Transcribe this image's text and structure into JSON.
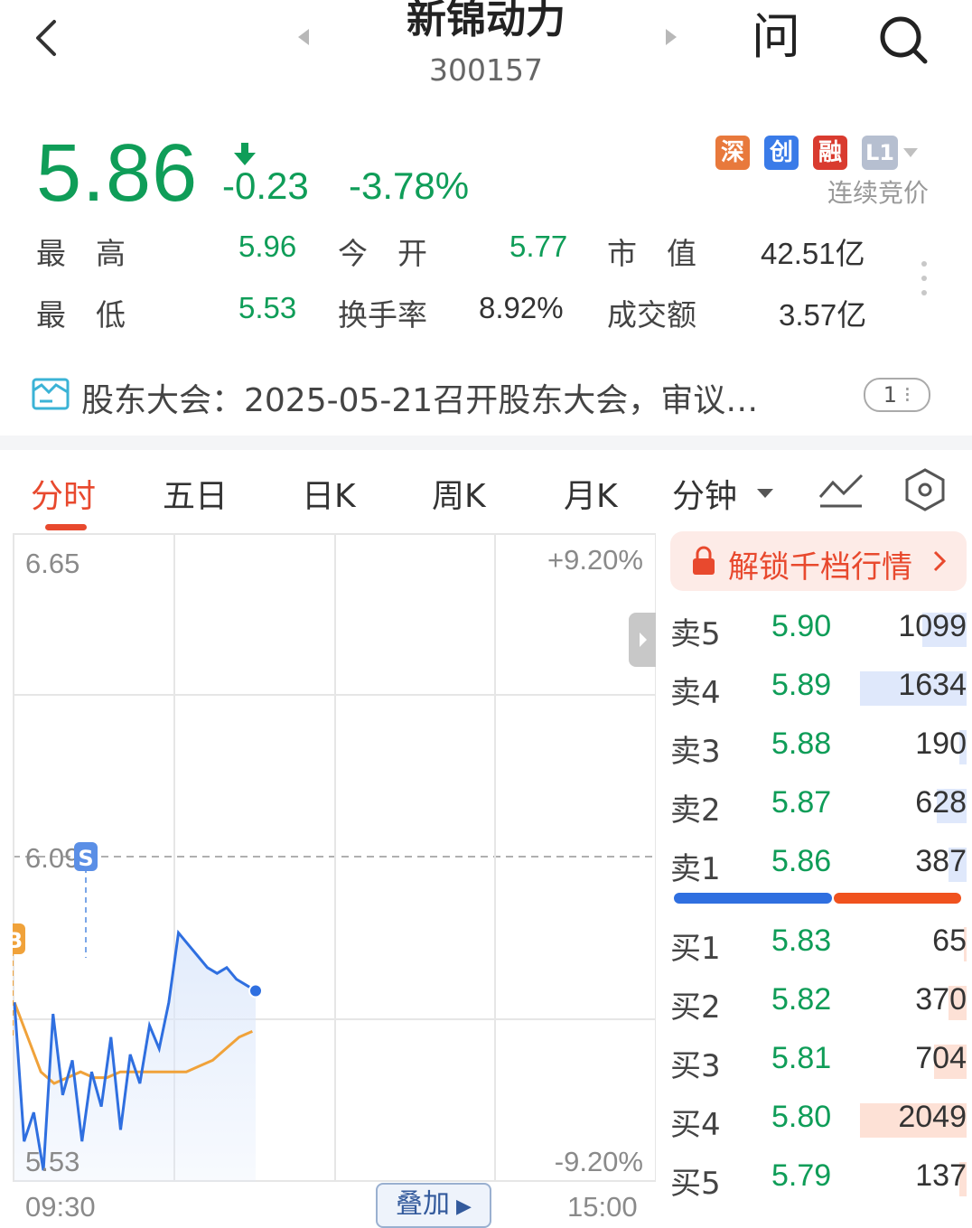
{
  "header": {
    "title": "新锦动力",
    "code": "300157",
    "ask_label": "问"
  },
  "quote": {
    "price": "5.86",
    "change": "-0.23",
    "change_pct": "-3.78%",
    "badges": [
      "深",
      "创",
      "融",
      "L1"
    ],
    "auction_label": "连续竞价",
    "stats": [
      {
        "label": "最　高",
        "value": "5.96"
      },
      {
        "label": "今　开",
        "value": "5.77"
      },
      {
        "label": "市　值",
        "value": "42.51亿"
      },
      {
        "label": "最　低",
        "value": "5.53"
      },
      {
        "label": "换手率",
        "value": "8.92%"
      },
      {
        "label": "成交额",
        "value": "3.57亿"
      }
    ]
  },
  "news": {
    "text": "股东大会：2025-05-21召开股东大会，审议…",
    "pager": "1"
  },
  "tabs": [
    "分时",
    "五日",
    "日K",
    "周K",
    "月K",
    "分钟"
  ],
  "chart": {
    "y_top": "6.65",
    "y_mid": "6.09",
    "y_bottom": "5.53",
    "pct_top": "+9.20%",
    "pct_bottom": "-9.20%",
    "time_start": "09:30",
    "time_end": "15:00",
    "marker_buy": "B",
    "marker_sell": "S",
    "overlay_label": "叠加"
  },
  "chart_data": {
    "type": "line",
    "ylim": [
      5.53,
      6.65
    ],
    "series": [
      {
        "values": [
          5.84,
          5.6,
          5.65,
          5.55,
          5.82,
          5.68,
          5.74,
          5.6,
          5.72,
          5.66,
          5.78,
          5.62,
          5.75,
          5.7,
          5.8,
          5.76,
          5.84,
          5.96,
          5.94,
          5.92,
          5.9,
          5.89,
          5.9,
          5.88,
          5.87,
          5.86
        ]
      },
      {
        "values": [
          5.84,
          5.78,
          5.72,
          5.7,
          5.71,
          5.72,
          5.71,
          5.71,
          5.72,
          5.72,
          5.72,
          5.72,
          5.72,
          5.72,
          5.73,
          5.74,
          5.76,
          5.78,
          5.79
        ]
      }
    ]
  },
  "orderbook": {
    "unlock_label": "解锁千档行情",
    "asks": [
      {
        "label": "卖5",
        "price": "5.90",
        "volume": "1099",
        "share": 0.3
      },
      {
        "label": "卖4",
        "price": "5.89",
        "volume": "1634",
        "share": 0.72
      },
      {
        "label": "卖3",
        "price": "5.88",
        "volume": "190",
        "share": 0.05
      },
      {
        "label": "卖2",
        "price": "5.87",
        "volume": "628",
        "share": 0.2
      },
      {
        "label": "卖1",
        "price": "5.86",
        "volume": "387",
        "share": 0.12
      }
    ],
    "bids": [
      {
        "label": "买1",
        "price": "5.83",
        "volume": "65",
        "share": 0.02
      },
      {
        "label": "买2",
        "price": "5.82",
        "volume": "370",
        "share": 0.12
      },
      {
        "label": "买3",
        "price": "5.81",
        "volume": "704",
        "share": 0.22
      },
      {
        "label": "买4",
        "price": "5.80",
        "volume": "2049",
        "share": 0.72
      },
      {
        "label": "买5",
        "price": "5.79",
        "volume": "137",
        "share": 0.05
      }
    ],
    "buy_ratio": 0.55,
    "colors": {
      "ask_bar": "#dfe8fb",
      "bid_bar": "#fde1d6",
      "buy": "#2f6fe0",
      "sell": "#f0521e"
    }
  }
}
